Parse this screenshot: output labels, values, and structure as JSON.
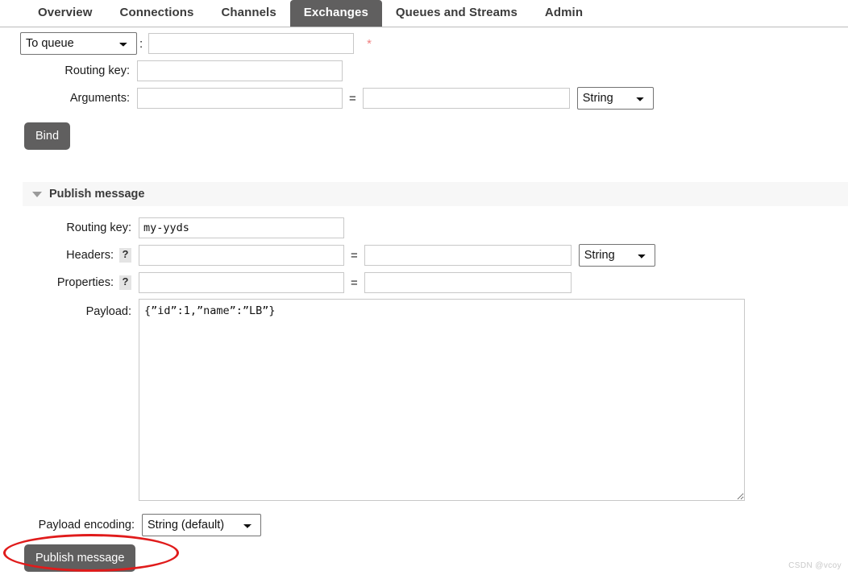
{
  "nav": {
    "tabs": [
      {
        "label": "Overview",
        "active": false
      },
      {
        "label": "Connections",
        "active": false
      },
      {
        "label": "Channels",
        "active": false
      },
      {
        "label": "Exchanges",
        "active": true
      },
      {
        "label": "Queues and Streams",
        "active": false
      },
      {
        "label": "Admin",
        "active": false
      }
    ]
  },
  "bind_form": {
    "destination_type": {
      "selected": "To queue",
      "options": [
        "To queue",
        "To exchange"
      ]
    },
    "destination_colon": ":",
    "destination_value": "",
    "destination_placeholder": "",
    "required_marker": "*",
    "routing_key_label": "Routing key:",
    "routing_key_value": "",
    "arguments_label": "Arguments:",
    "argument_name_value": "",
    "argument_equals": "=",
    "argument_value_value": "",
    "argument_type": {
      "selected": "String",
      "options": [
        "String",
        "Number",
        "Boolean",
        "List"
      ]
    },
    "bind_button_label": "Bind"
  },
  "publish_section": {
    "title": "Publish message",
    "caret_icon": "caret-down-icon",
    "expanded": true,
    "routing_key_label": "Routing key:",
    "routing_key_value": "my-yyds",
    "headers_label": "Headers:",
    "headers_help_icon": "?",
    "header_name_value": "",
    "header_equals": "=",
    "header_value_value": "",
    "header_type": {
      "selected": "String",
      "options": [
        "String",
        "Number",
        "Boolean",
        "List"
      ]
    },
    "properties_label": "Properties:",
    "properties_help_icon": "?",
    "property_name_value": "",
    "property_equals": "=",
    "property_value_value": "",
    "payload_label": "Payload:",
    "payload_value": "{”id”:1,”name”:”LB”}",
    "payload_encoding_label": "Payload encoding:",
    "payload_encoding": {
      "selected": "String (default)",
      "options": [
        "String (default)",
        "Base64"
      ]
    },
    "publish_button_label": "Publish message"
  },
  "annotation": {
    "shape": "red-ellipse",
    "color": "#e01b1b",
    "target": "publish-message-button"
  },
  "watermark": {
    "text": "CSDN @vcoy"
  }
}
